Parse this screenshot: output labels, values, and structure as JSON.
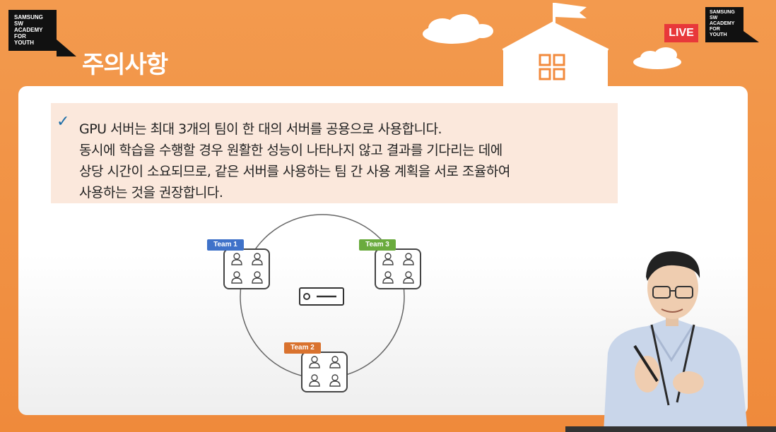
{
  "header": {
    "logo_left": [
      "SAMSUNG",
      "SW",
      "ACADEMY",
      "FOR",
      "YOUTH"
    ],
    "logo_right": [
      "SAMSUNG",
      "SW",
      "ACADEMY",
      "FOR",
      "YOUTH"
    ],
    "title": "주의사항",
    "live_label": "LIVE"
  },
  "notice": {
    "lines": [
      "GPU 서버는 최대 3개의 팀이 한 대의 서버를 공용으로 사용합니다.",
      "동시에 학습을 수행할 경우 원활한 성능이 나타나지 않고 결과를 기다리는 데에",
      "상당 시간이 소요되므로,  같은 서버를 사용하는 팀 간 사용 계획을 서로 조율하여",
      "사용하는 것을 권장합니다."
    ]
  },
  "diagram": {
    "teams": [
      {
        "label": "Team 1",
        "color": "#3f72c9"
      },
      {
        "label": "Team 3",
        "color": "#6aab3e"
      },
      {
        "label": "Team 2",
        "color": "#d9722e"
      }
    ],
    "server_icon": "server-icon"
  },
  "colors": {
    "background": "#f28a3c",
    "live": "#e8383a",
    "notice_bg": "#fbe8dc",
    "check": "#1d6ea8"
  }
}
